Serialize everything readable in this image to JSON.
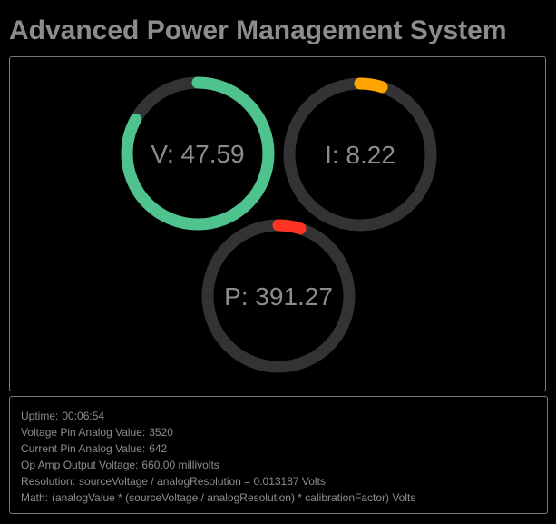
{
  "app": {
    "title": "Advanced Power Management System"
  },
  "gauges": [
    {
      "id": "voltage",
      "text": "V: 47.59",
      "fill_fraction": 0.83,
      "color": "#4fc38d"
    },
    {
      "id": "current",
      "text": "I: 8.22",
      "fill_fraction": 0.05,
      "color": "#ffa500"
    },
    {
      "id": "power",
      "text": "P: 391.27",
      "fill_fraction": 0.05,
      "color": "#ff3322"
    }
  ],
  "track_color": "#333333",
  "info": {
    "uptime": {
      "label": "Uptime:",
      "value": "00:06:54"
    },
    "voltage_pin": {
      "label": "Voltage Pin Analog Value:",
      "value": "3520"
    },
    "current_pin": {
      "label": "Current Pin Analog Value:",
      "value": "642"
    },
    "op_amp": {
      "label": "Op Amp Output Voltage:",
      "value": "660.00 millivolts"
    },
    "resolution": {
      "label": "Resolution:",
      "value": "sourceVoltage / analogResolution = 0.013187 Volts"
    },
    "math": {
      "label": "Math:",
      "value": "(analogValue * (sourceVoltage / analogResolution) * calibrationFactor) Volts"
    }
  }
}
